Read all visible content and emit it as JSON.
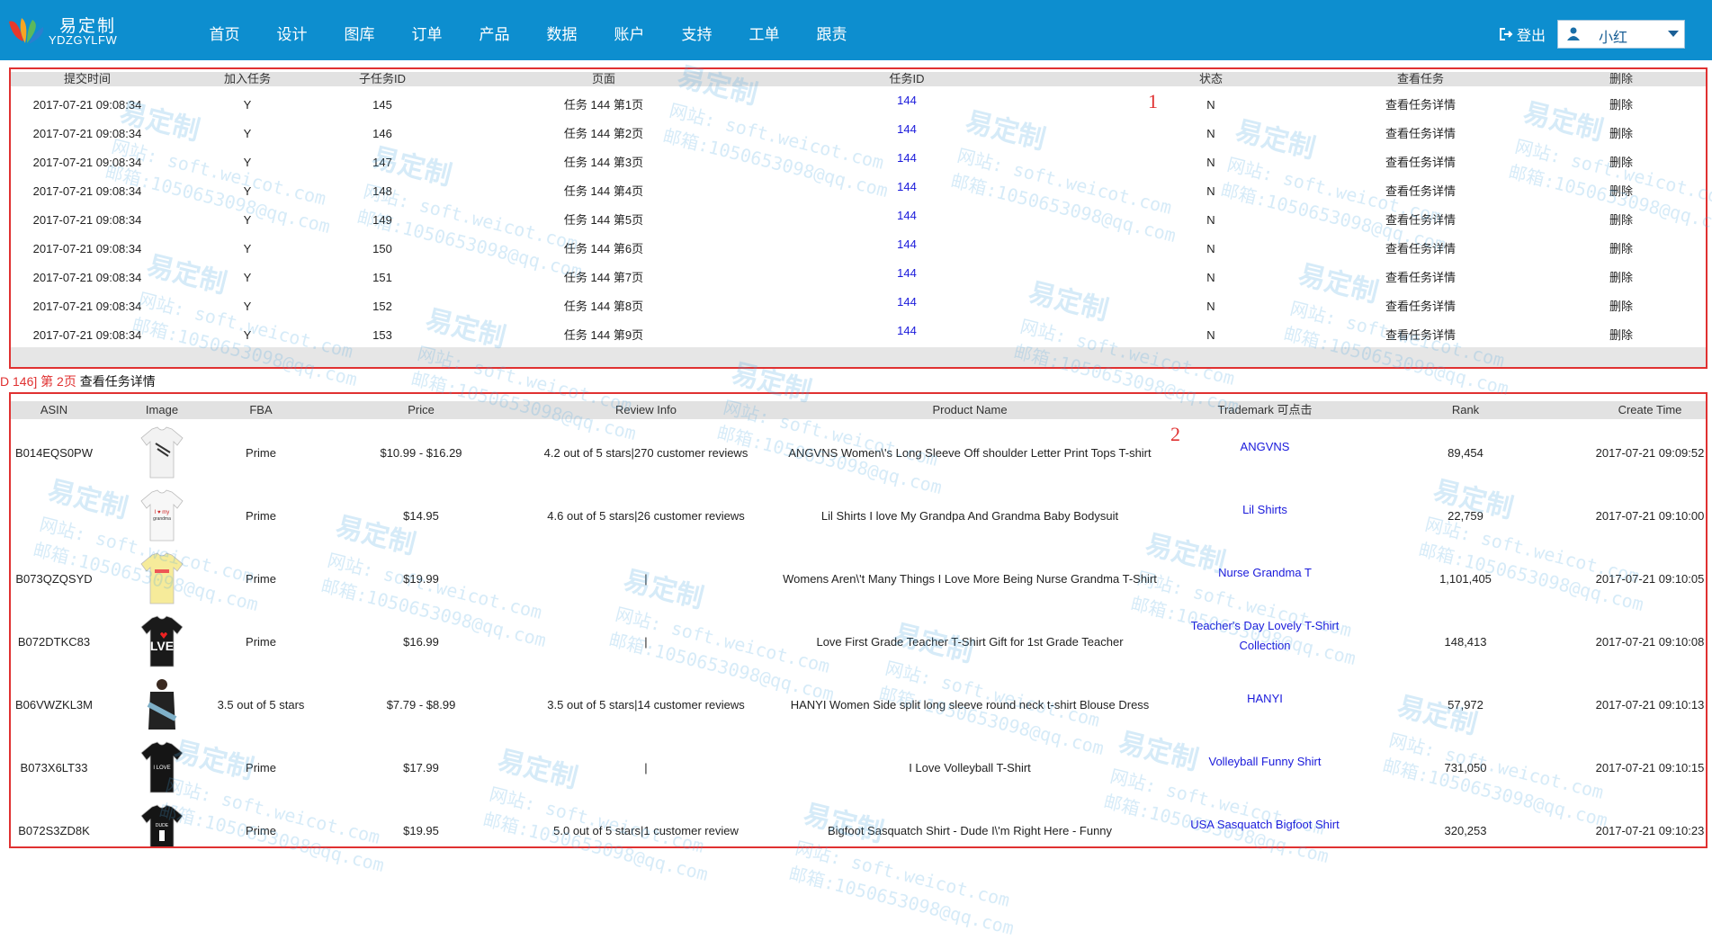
{
  "header": {
    "logo_cn": "易定制",
    "logo_en": "YDZGYLFW",
    "nav": [
      "首页",
      "设计",
      "图库",
      "订单",
      "产品",
      "数据",
      "账户",
      "支持",
      "工单",
      "跟责"
    ],
    "logout_label": "登出",
    "user_name": "小红"
  },
  "table1": {
    "columns": [
      "提交时间",
      "加入任务",
      "子任务ID",
      "页面",
      "任务ID",
      "状态",
      "查看任务",
      "删除"
    ],
    "rows": [
      {
        "time": "2017-07-21 09:08:34",
        "joined": "Y",
        "subtask_id": "145",
        "page": "任务 144 第1页",
        "task_id": "144",
        "status": "N",
        "view": "查看任务详情",
        "delete": "删除"
      },
      {
        "time": "2017-07-21 09:08:34",
        "joined": "Y",
        "subtask_id": "146",
        "page": "任务 144 第2页",
        "task_id": "144",
        "status": "N",
        "view": "查看任务详情",
        "delete": "删除"
      },
      {
        "time": "2017-07-21 09:08:34",
        "joined": "Y",
        "subtask_id": "147",
        "page": "任务 144 第3页",
        "task_id": "144",
        "status": "N",
        "view": "查看任务详情",
        "delete": "删除"
      },
      {
        "time": "2017-07-21 09:08:34",
        "joined": "Y",
        "subtask_id": "148",
        "page": "任务 144 第4页",
        "task_id": "144",
        "status": "N",
        "view": "查看任务详情",
        "delete": "删除"
      },
      {
        "time": "2017-07-21 09:08:34",
        "joined": "Y",
        "subtask_id": "149",
        "page": "任务 144 第5页",
        "task_id": "144",
        "status": "N",
        "view": "查看任务详情",
        "delete": "删除"
      },
      {
        "time": "2017-07-21 09:08:34",
        "joined": "Y",
        "subtask_id": "150",
        "page": "任务 144 第6页",
        "task_id": "144",
        "status": "N",
        "view": "查看任务详情",
        "delete": "删除"
      },
      {
        "time": "2017-07-21 09:08:34",
        "joined": "Y",
        "subtask_id": "151",
        "page": "任务 144 第7页",
        "task_id": "144",
        "status": "N",
        "view": "查看任务详情",
        "delete": "删除"
      },
      {
        "time": "2017-07-21 09:08:34",
        "joined": "Y",
        "subtask_id": "152",
        "page": "任务 144 第8页",
        "task_id": "144",
        "status": "N",
        "view": "查看任务详情",
        "delete": "删除"
      },
      {
        "time": "2017-07-21 09:08:34",
        "joined": "Y",
        "subtask_id": "153",
        "page": "任务 144 第9页",
        "task_id": "144",
        "status": "N",
        "view": "查看任务详情",
        "delete": "删除"
      }
    ]
  },
  "markers": {
    "one": "1",
    "two": "2"
  },
  "breadcrumb": {
    "prefix": "D 146] 第 2页",
    "link": "查看任务详情"
  },
  "table2": {
    "columns": [
      "ASIN",
      "Image",
      "FBA",
      "Price",
      "Review Info",
      "Product Name",
      "Trademark 可点击",
      "Rank",
      "Create Time"
    ],
    "rows": [
      {
        "asin": "B014EQS0PW",
        "fba": "Prime",
        "price": "$10.99 - $16.29",
        "review": "4.2 out of 5 stars|270 customer reviews",
        "name": "ANGVNS Women\\'s Long Sleeve Off shoulder Letter Print Tops T-shirt",
        "trademark": "ANGVNS",
        "rank": "89,454",
        "created": "2017-07-21 09:09:52",
        "shirt": "white"
      },
      {
        "asin": "",
        "fba": "Prime",
        "price": "$14.95",
        "review": "4.6 out of 5 stars|26 customer reviews",
        "name": "Lil Shirts I love My Grandpa And Grandma Baby Bodysuit",
        "trademark": "Lil Shirts",
        "rank": "22,759",
        "created": "2017-07-21 09:10:00",
        "shirt": "bodysuit"
      },
      {
        "asin": "B073QZQSYD",
        "fba": "Prime",
        "price": "$19.99",
        "review": "|",
        "name": "Womens Aren\\'t Many Things I Love More Being Nurse Grandma T-Shirt",
        "trademark": "Nurse Grandma T",
        "rank": "1,101,405",
        "created": "2017-07-21 09:10:05",
        "shirt": "yellow"
      },
      {
        "asin": "B072DTKC83",
        "fba": "Prime",
        "price": "$16.99",
        "review": "|",
        "name": "Love First Grade Teacher T-Shirt Gift for 1st Grade Teacher",
        "trademark": "Teacher's Day Lovely T-Shirt Collection",
        "rank": "148,413",
        "created": "2017-07-21 09:10:08",
        "shirt": "black-love"
      },
      {
        "asin": "B06VWZKL3M",
        "fba": "3.5 out of 5 stars",
        "price": "$7.79 - $8.99",
        "review": "3.5 out of 5 stars|14 customer reviews",
        "name": "HANYI Women Side split long sleeve round neck t-shirt Blouse Dress",
        "trademark": "HANYI",
        "rank": "57,972",
        "created": "2017-07-21 09:10:13",
        "shirt": "model"
      },
      {
        "asin": "B073X6LT33",
        "fba": "Prime",
        "price": "$17.99",
        "review": "|",
        "name": "I Love Volleyball T-Shirt",
        "trademark": "Volleyball Funny Shirt",
        "rank": "731,050",
        "created": "2017-07-21 09:10:15",
        "shirt": "black"
      },
      {
        "asin": "B072S3ZD8K",
        "fba": "Prime",
        "price": "$19.95",
        "review": "5.0 out of 5 stars|1 customer review",
        "name": "Bigfoot Sasquatch Shirt - Dude I\\'m Right Here - Funny",
        "trademark": "USA Sasquatch Bigfoot Shirt",
        "rank": "320,253",
        "created": "2017-07-21 09:10:23",
        "shirt": "black-bigfoot"
      }
    ]
  },
  "watermark": {
    "brand": "易定制",
    "site": "网站: soft.weicot.com",
    "mail": "邮箱:1050653098@qq.com"
  },
  "colors": {
    "topbar": "#0d8ecf",
    "highlight_box": "#e03131",
    "link": "#1a1adb"
  }
}
